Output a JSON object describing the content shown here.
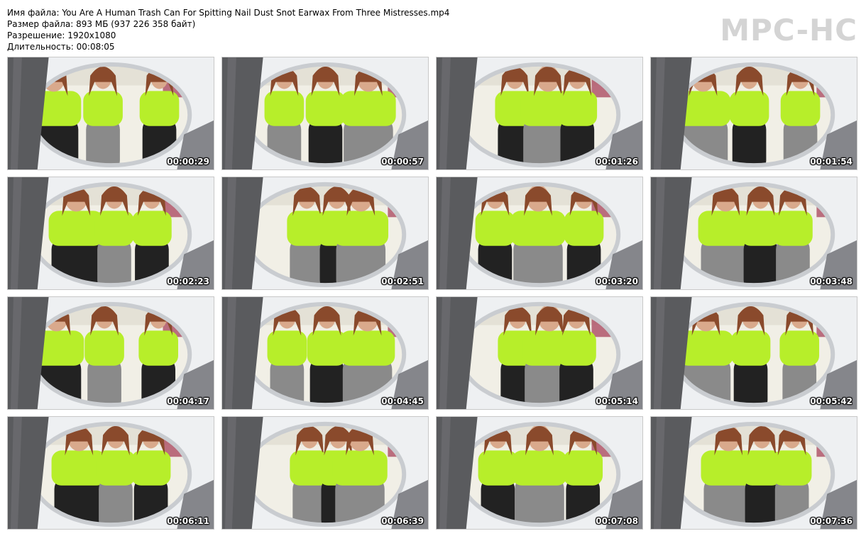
{
  "info": {
    "filename": "Имя файла: You Are A Human Trash Can For Spitting  Nail Dust  Snot  Earwax From Three Mistresses.mp4",
    "filesize": "Размер файла: 893 МБ (937 226 358 байт)",
    "resolution": "Разрешение: 1920x1080",
    "duration": "Длительность: 00:08:05"
  },
  "logo": "MPC-HC",
  "colors": {
    "shirt_neon": "#b7ee2a",
    "seat_white": "#eef0f2",
    "wall": "#f1efe6",
    "pants": "#222222",
    "leggings": "#8a8a8a"
  },
  "thumbnails": [
    {
      "time": "00:00:29"
    },
    {
      "time": "00:00:57"
    },
    {
      "time": "00:01:26"
    },
    {
      "time": "00:01:54"
    },
    {
      "time": "00:02:23"
    },
    {
      "time": "00:02:51"
    },
    {
      "time": "00:03:20"
    },
    {
      "time": "00:03:48"
    },
    {
      "time": "00:04:17"
    },
    {
      "time": "00:04:45"
    },
    {
      "time": "00:05:14"
    },
    {
      "time": "00:05:42"
    },
    {
      "time": "00:06:11"
    },
    {
      "time": "00:06:39"
    },
    {
      "time": "00:07:08"
    },
    {
      "time": "00:07:36"
    }
  ]
}
